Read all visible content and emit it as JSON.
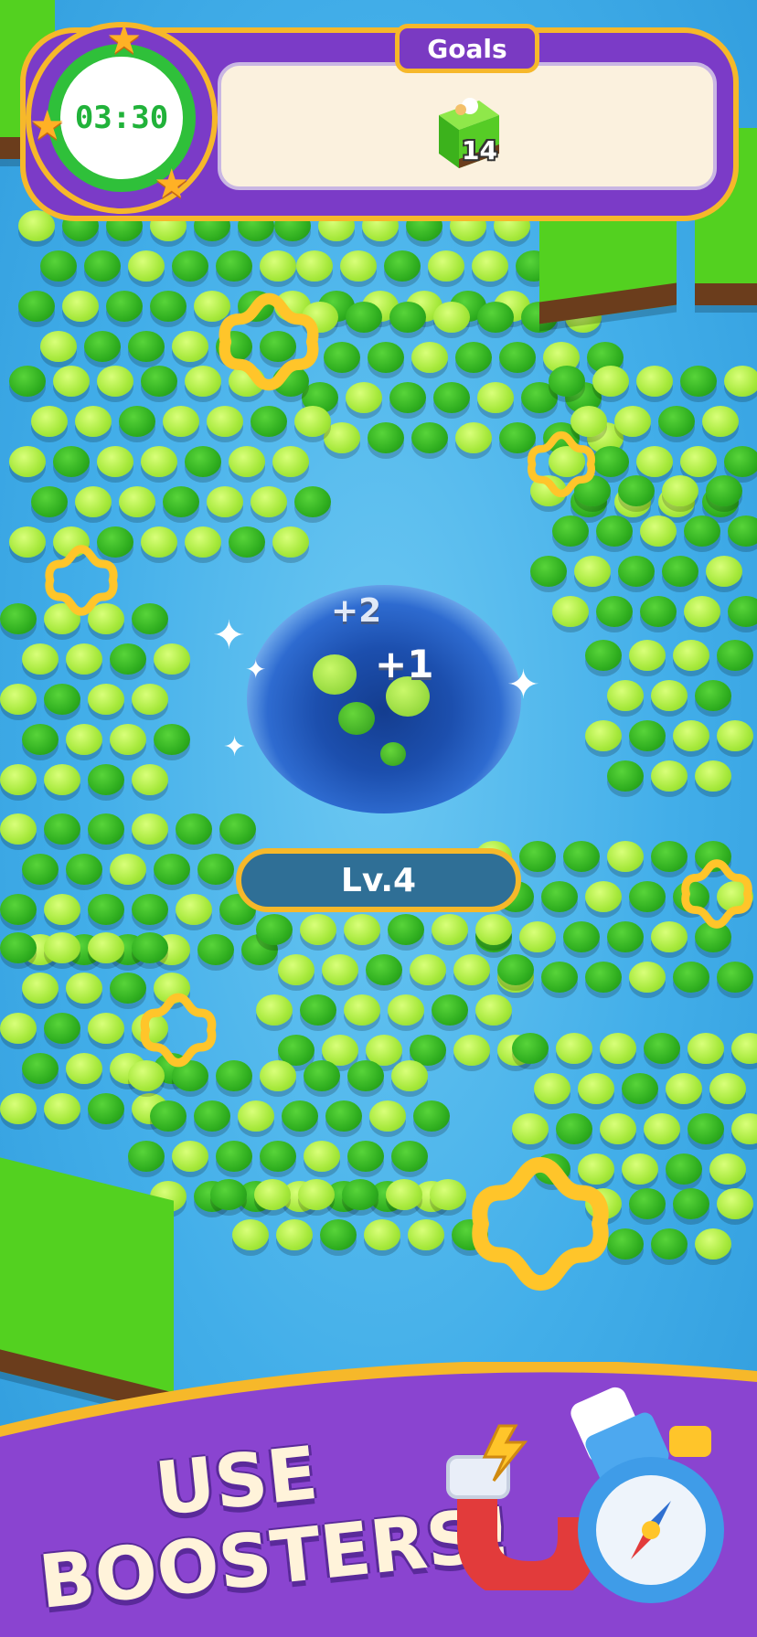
{
  "hud": {
    "timer": "03:30",
    "goals_label": "Goals",
    "goal": {
      "icon": "grass-block-icon",
      "count": "14"
    }
  },
  "hole": {
    "level_label": "Lv.4",
    "score_pops": [
      "+2",
      "+1"
    ]
  },
  "promo": {
    "line1": "USE",
    "line2": "BOOSTERS!",
    "boosters": [
      "magnet-icon",
      "compass-icon"
    ]
  },
  "colors": {
    "hud_purple": "#7b3bc7",
    "hud_gold": "#f6b82a",
    "timer_green": "#2fc03a",
    "water_blue": "#42aee9",
    "pea_light": "#a5e83a",
    "pea_dark": "#2fae1f"
  }
}
